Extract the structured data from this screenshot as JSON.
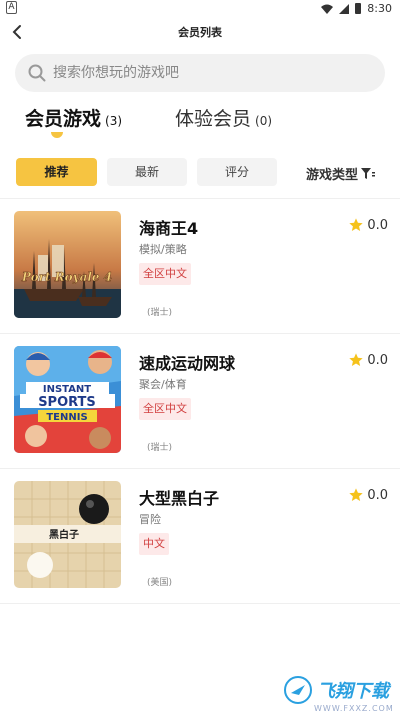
{
  "status": {
    "time": "8:30",
    "app_icon": "A"
  },
  "header": {
    "title": "会员列表",
    "back_icon": "chevron-left-icon"
  },
  "search": {
    "placeholder": "搜索你想玩的游戏吧"
  },
  "tabs": [
    {
      "label": "会员游戏",
      "count": "(3)",
      "active": true
    },
    {
      "label": "体验会员",
      "count": "(0)",
      "active": false
    }
  ],
  "filters": {
    "chips": [
      {
        "label": "推荐",
        "active": true
      },
      {
        "label": "最新",
        "active": false
      },
      {
        "label": "评分",
        "active": false
      }
    ],
    "game_type_label": "游戏类型"
  },
  "games": [
    {
      "name": "海商王4",
      "genre": "模拟/策略",
      "tag": "全区中文",
      "region": "(瑞士)",
      "rating": "0.0",
      "thumb_text": "Port Royale 4"
    },
    {
      "name": "速成运动网球",
      "genre": "聚会/体育",
      "tag": "全区中文",
      "region": "(瑞士)",
      "rating": "0.0",
      "thumb_text_1": "INSTANT",
      "thumb_text_2": "SPORTS",
      "thumb_text_3": "TENNIS"
    },
    {
      "name": "大型黑白子",
      "genre": "冒险",
      "tag": "中文",
      "region": "(美国)",
      "rating": "0.0",
      "thumb_text": "黑白子"
    }
  ],
  "watermark": {
    "text": "飞翔下载",
    "url": "WWW.FXXZ.COM"
  },
  "colors": {
    "accent": "#f6c441",
    "tag_bg": "#fde9e9",
    "tag_text": "#d14040",
    "star": "#f5c21b"
  }
}
